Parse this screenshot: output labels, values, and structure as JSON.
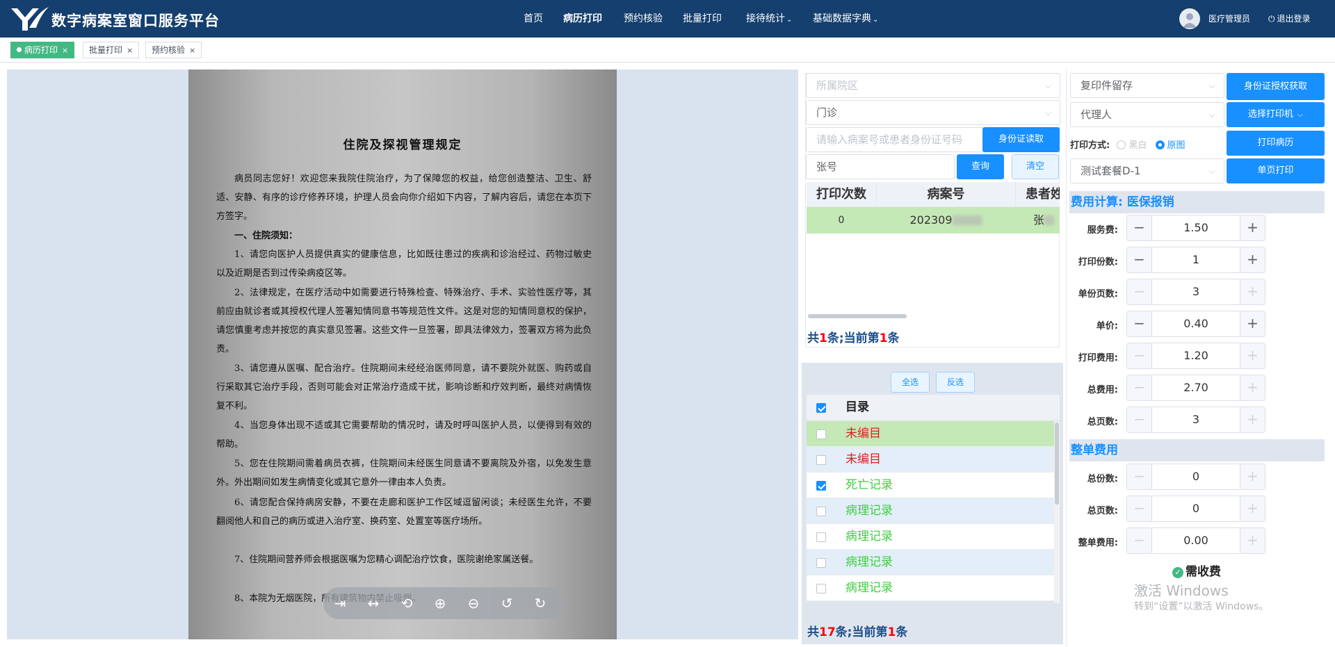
{
  "header": {
    "title": "数字病案室窗口服务平台",
    "nav": [
      "首页",
      "病历打印",
      "预约核验",
      "批量打印",
      "接待统计",
      "基础数据字典"
    ],
    "user": "医疗管理员",
    "logout": "退出登录"
  },
  "tabs": [
    "病历打印",
    "批量打印",
    "预约核验"
  ],
  "document": {
    "title": "住院及探视管理规定",
    "paragraphs": [
      "病员同志您好！欢迎您来我院住院治疗，为了保障您的权益，给您创造整洁、卫生、舒适、安静、有序的诊疗修养环境，护理人员会向你介绍如下内容，了解内容后，请您在本页下方签字。",
      "一、住院须知：",
      "1、请您向医护人员提供真实的健康信息，比如既往患过的疾病和诊治经过、药物过敏史以及近期是否到过传染病疫区等。",
      "2、法律规定，在医疗活动中如需要进行特殊检查、特殊治疗、手术、实验性医疗等，其前应由就诊者或其授权代理人签署知情同意书等规范性文件。这是对您的知情同意权的保护，请您慎重考虑并按您的真实意见签署。这些文件一旦签署，即具法律效力，签署双方将为此负责。",
      "3、请您遵从医嘱、配合治疗。住院期间未经经治医师同意，请不要院外就医、购药或自行采取其它治疗手段，否则可能会对正常治疗造成干扰，影响诊断和疗效判断，最终对病情恢复不利。",
      "4、当您身体出现不适或其它需要帮助的情况时，请及时呼叫医护人员，以便得到有效的帮助。",
      "5、您在住院期间需着病员衣裤，住院期间未经医生同意请不要离院及外宿，以免发生意外。外出期间如发生病情变化或其它意外一律由本人负责。",
      "6、请您配合保持病房安静，不要在走廊和医护工作区域逗留闲谈；未经医生允许，不要翻阅他人和自己的病历或进入治疗室、换药室、处置室等医疗场所。",
      "7、住院期间营养师会根据医嘱为您精心调配治疗饮食，医院谢绝家属送餐。",
      "8、本院为无烟医院，所有建筑物内禁止吸烟。"
    ]
  },
  "search": {
    "hospital_placeholder": "所属院区",
    "visit_type": "门诊",
    "id_placeholder": "请输入病案号或患者身份证号码",
    "id_read_button": "身份证读取",
    "number_value": "张号",
    "query_button": "查询",
    "clear_button": "清空"
  },
  "record_table": {
    "columns": [
      "打印次数",
      "病案号",
      "患者姓"
    ],
    "rows": [
      {
        "count": "0",
        "record_no": "202309",
        "name": "张"
      }
    ],
    "pager": {
      "prefix": "共",
      "total": "1",
      "mid": "条;当前第",
      "current": "1",
      "suffix": "条"
    }
  },
  "catalog": {
    "select_all": "全选",
    "invert": "反选",
    "header": "目录",
    "items": [
      {
        "label": "未编目",
        "checked": false,
        "color": "#e02020"
      },
      {
        "label": "未编目",
        "checked": false,
        "color": "#e02020"
      },
      {
        "label": "死亡记录",
        "checked": true,
        "color": "#3fcf3f"
      },
      {
        "label": "病理记录",
        "checked": false,
        "color": "#3fcf3f"
      },
      {
        "label": "病理记录",
        "checked": false,
        "color": "#3fcf3f"
      },
      {
        "label": "病理记录",
        "checked": false,
        "color": "#3fcf3f"
      },
      {
        "label": "病理记录",
        "checked": false,
        "color": "#3fcf3f"
      }
    ],
    "pager": {
      "prefix": "共",
      "total": "17",
      "mid": "条;当前第",
      "current": "1",
      "suffix": "条"
    }
  },
  "print_settings": {
    "purpose": "复印件留存",
    "id_auth_button": "身份证授权获取",
    "agent": "代理人",
    "select_printer_button": "选择打印机",
    "print_mode_label": "打印方式:",
    "mode_bw": "黑白",
    "mode_original": "原图",
    "print_record_button": "打印病历",
    "package": "测试套餐D-1",
    "single_page_button": "单页打印"
  },
  "fee": {
    "section_title": "费用计算:",
    "section_type": "医保报销",
    "fields": [
      {
        "label": "服务费:",
        "value": "1.50"
      },
      {
        "label": "打印份数:",
        "value": "1"
      },
      {
        "label": "单份页数:",
        "value": "3"
      },
      {
        "label": "单价:",
        "value": "0.40"
      },
      {
        "label": "打印费用:",
        "value": "1.20"
      },
      {
        "label": "总费用:",
        "value": "2.70"
      },
      {
        "label": "总页数:",
        "value": "3"
      }
    ],
    "whole_title": "整单费用",
    "whole_fields": [
      {
        "label": "总份数:",
        "value": "0"
      },
      {
        "label": "总页数:",
        "value": "0"
      },
      {
        "label": "整单费用:",
        "value": "0.00"
      }
    ],
    "charge_status": "需收费"
  },
  "watermark": {
    "line1": "激活 Windows",
    "line2": "转到“设置”以激活 Windows。"
  },
  "colors": {
    "header_bg": "#143f6e",
    "accent": "#1890ff",
    "tab_active": "#42b983",
    "row_selected": "#c5e8b7"
  }
}
